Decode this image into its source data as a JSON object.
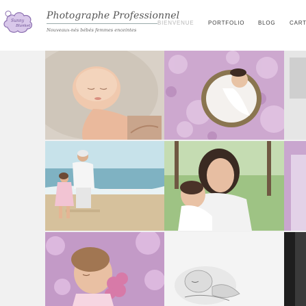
{
  "site": {
    "logo_text_line1": "Sunny",
    "logo_text_line2": "Blanket",
    "title": "Photographe Professionnel",
    "tagline": "Nouveaux-nés  bébés  femmes  enceintes"
  },
  "nav": {
    "items": [
      {
        "label": "BIENVENUE",
        "state": "muted"
      },
      {
        "label": "PORTFOLIO",
        "state": "normal"
      },
      {
        "label": "BLOG",
        "state": "normal"
      },
      {
        "label": "CART",
        "state": "normal"
      }
    ]
  },
  "gallery": {
    "photos": [
      {
        "subject": "sleeping-newborn"
      },
      {
        "subject": "baby-in-basket-among-pink-blossoms"
      },
      {
        "subject": "grandfather-and-girl-at-beach"
      },
      {
        "subject": "mother-hugging-baby-in-park"
      },
      {
        "subject": "girl-with-pink-flowers"
      },
      {
        "subject": "black-and-white-newborn"
      },
      {
        "subject": "partial-photo-right-top"
      },
      {
        "subject": "partial-photo-right-middle"
      },
      {
        "subject": "partial-photo-right-bottom"
      }
    ]
  },
  "colors": {
    "logo_purple": "#8b6fb0",
    "nav_text": "#3a3a3a",
    "nav_muted": "#b8b8b8"
  }
}
